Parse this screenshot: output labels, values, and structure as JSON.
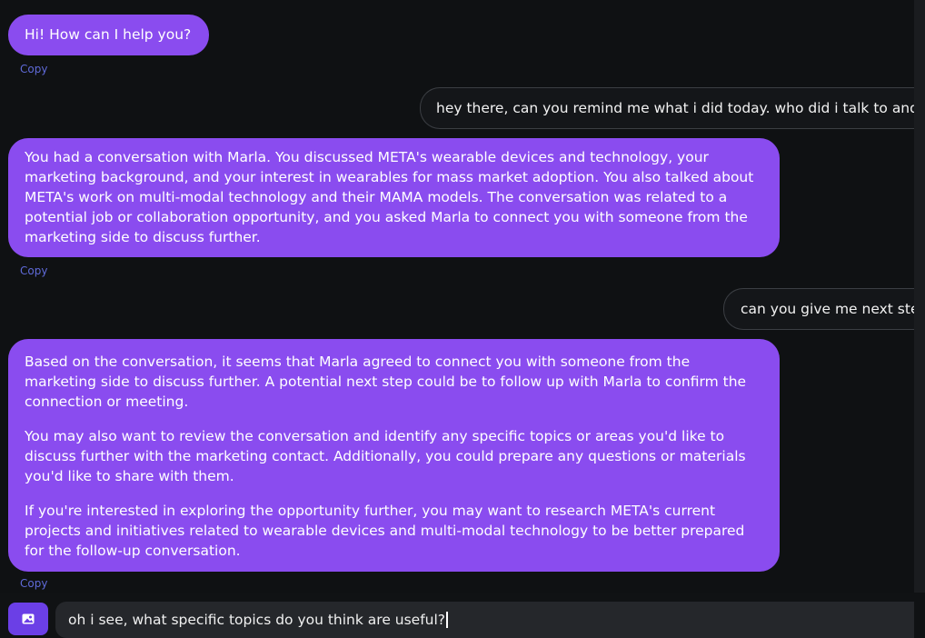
{
  "messages": [
    {
      "role": "assistant",
      "paragraphs": [
        "Hi! How can I help you?"
      ],
      "copy_label": "Copy"
    },
    {
      "role": "user",
      "text": "hey there, can you remind me what i did today. who did i talk to and"
    },
    {
      "role": "assistant",
      "paragraphs": [
        "You had a conversation with Marla. You discussed META's wearable devices and technology, your marketing background, and your interest in wearables for mass market adoption. You also talked about META's work on multi-modal technology and their MAMA models. The conversation was related to a potential job or collaboration opportunity, and you asked Marla to connect you with someone from the marketing side to discuss further."
      ],
      "copy_label": "Copy"
    },
    {
      "role": "user",
      "text": "can you give me next ste"
    },
    {
      "role": "assistant",
      "paragraphs": [
        "Based on the conversation, it seems that Marla agreed to connect you with someone from the marketing side to discuss further. A potential next step could be to follow up with Marla to confirm the connection or meeting.",
        "You may also want to review the conversation and identify any specific topics or areas you'd like to discuss further with the marketing contact. Additionally, you could prepare any questions or materials you'd like to share with them.",
        "If you're interested in exploring the opportunity further, you may want to research META's current projects and initiatives related to wearable devices and multi-modal technology to be better prepared for the follow-up conversation."
      ],
      "copy_label": "Copy"
    }
  ],
  "composer": {
    "input_value": "oh i see, what specific topics do you think are useful?",
    "image_button_icon": "image-icon"
  },
  "colors": {
    "assistant_bubble": "#8a4cef",
    "copy_link": "#5f6ad8",
    "image_button": "#6b3fe6",
    "background": "#0f1113"
  }
}
